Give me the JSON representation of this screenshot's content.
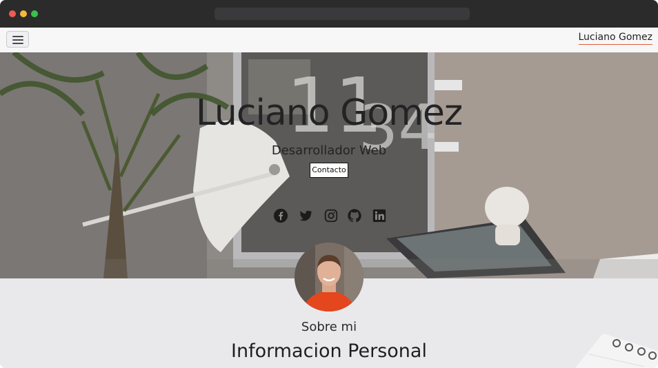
{
  "browser": {
    "url": ""
  },
  "navbar": {
    "menu_icon": "hamburger-icon",
    "brand": "Luciano Gomez"
  },
  "hero": {
    "title": "Luciano Gomez",
    "subtitle": "Desarrollador Web",
    "contact_label": "Contacto",
    "socials": [
      {
        "name": "facebook",
        "icon": "facebook-icon"
      },
      {
        "name": "twitter",
        "icon": "twitter-icon"
      },
      {
        "name": "instagram",
        "icon": "instagram-icon"
      },
      {
        "name": "github",
        "icon": "github-icon"
      },
      {
        "name": "linkedin",
        "icon": "linkedin-icon"
      }
    ]
  },
  "about": {
    "kicker": "Sobre mi",
    "title": "Informacion Personal"
  }
}
